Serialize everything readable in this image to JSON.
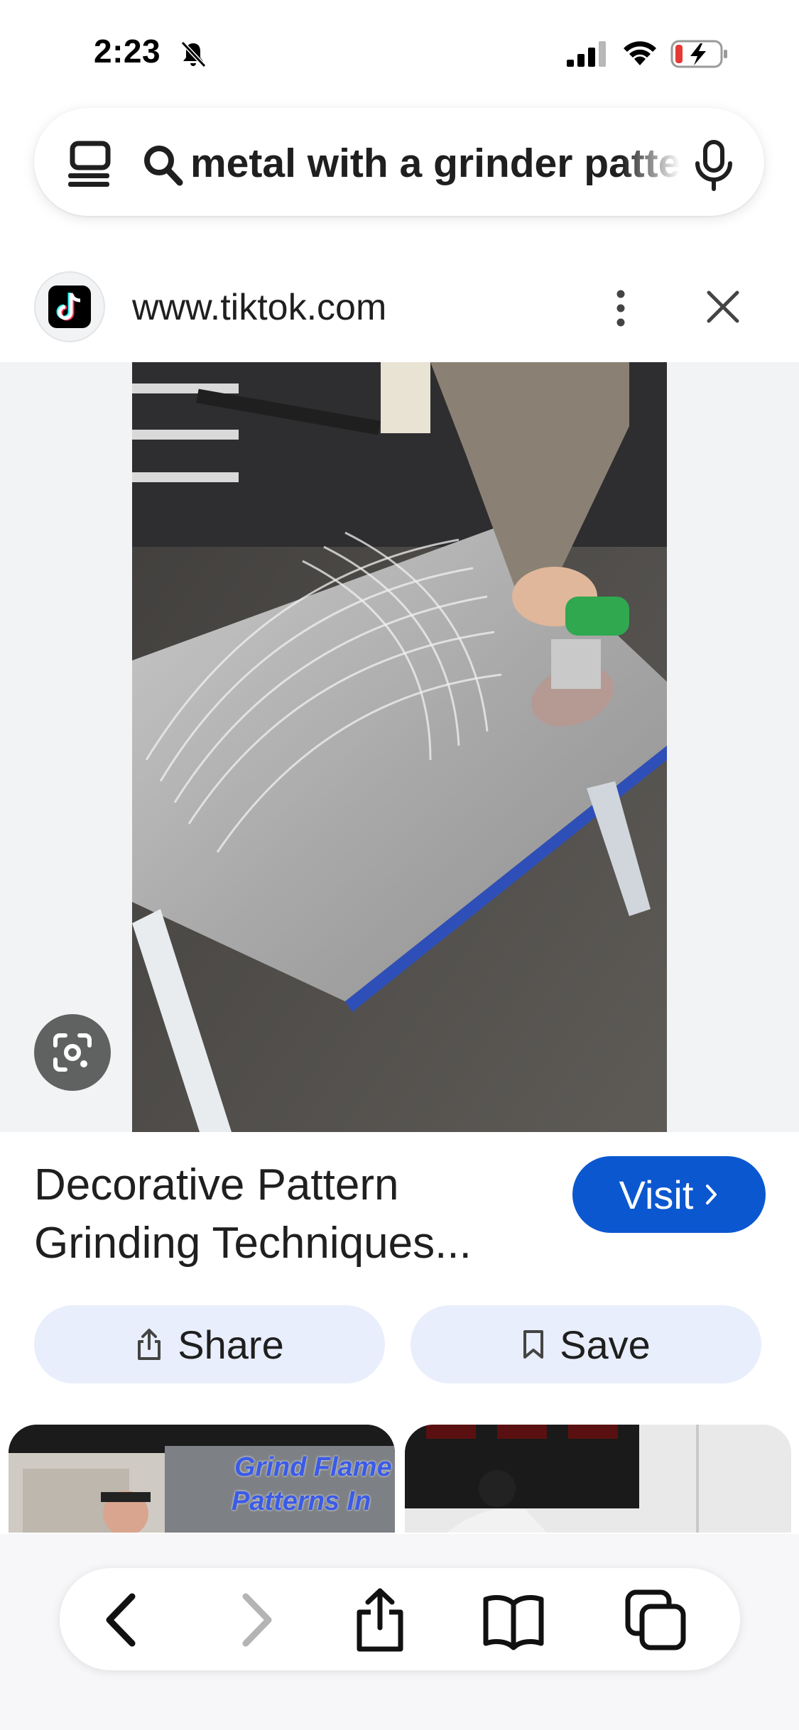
{
  "status_bar": {
    "time": "2:23"
  },
  "search": {
    "query": "metal with a grinder patterns"
  },
  "site": {
    "domain": "www.tiktok.com"
  },
  "result": {
    "title": "Decorative Pattern Grinding Techniques...",
    "visit_label": "Visit",
    "share_label": "Share",
    "save_label": "Save"
  },
  "thumbnails": [
    {
      "overlay_text_line1": "Grind Flame",
      "overlay_text_line2": "Patterns In"
    },
    {
      "overlay_text_line1": ""
    }
  ],
  "colors": {
    "accent": "#0b57d0",
    "pill_bg": "#e8eefb",
    "panel_bg": "#f1f3f4"
  }
}
